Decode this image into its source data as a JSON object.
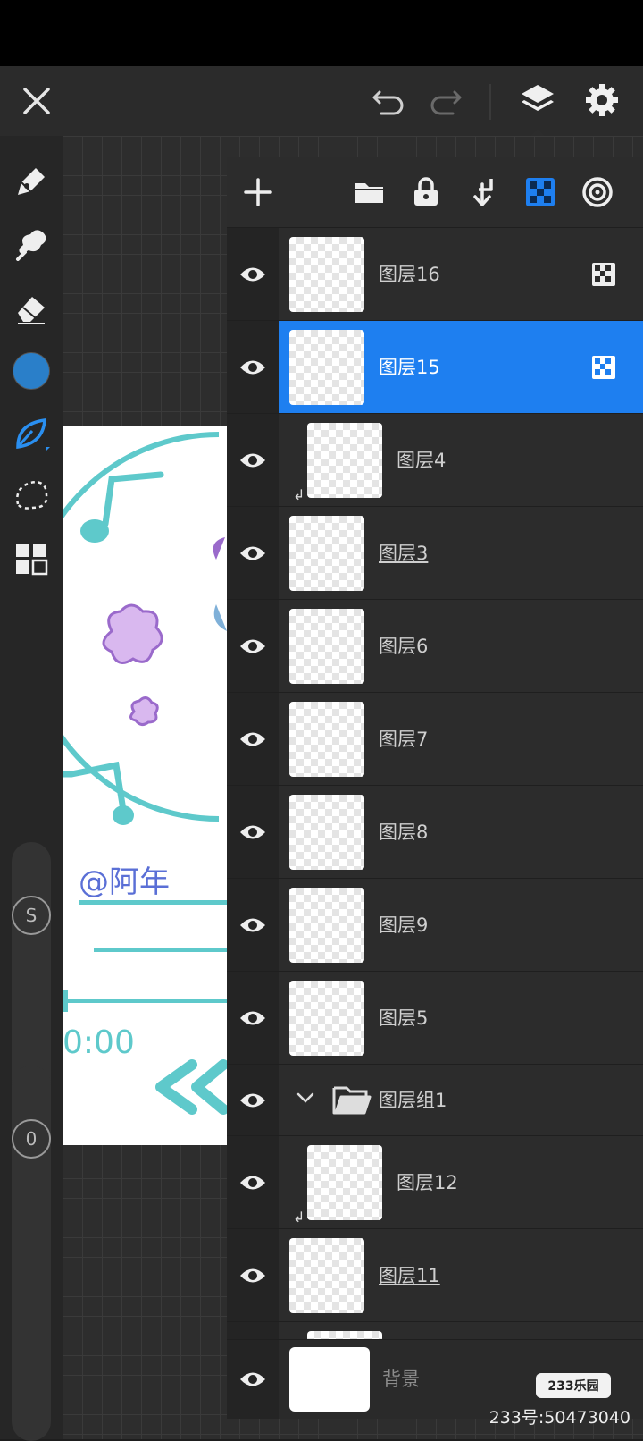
{
  "colors": {
    "accent": "#1e7ff0",
    "current_color": "#2a7fc9",
    "panel_bg": "#2c2c2c"
  },
  "topbar": {
    "icons": [
      "close-icon",
      "undo-icon",
      "redo-icon",
      "layers-icon",
      "settings-icon"
    ]
  },
  "tools": {
    "items": [
      "pen-icon",
      "smudge-icon",
      "eraser-icon",
      "color-swatch",
      "ink-brush-icon",
      "lasso-selection-icon",
      "grid-menu-icon"
    ],
    "size_label": "S",
    "opacity_label": "0"
  },
  "artwork": {
    "handle": "@阿年",
    "time": "0:00"
  },
  "layers_panel": {
    "header_icons": [
      "add-layer-icon",
      "folder-icon",
      "lock-icon",
      "clip-mask-icon",
      "alpha-lock-icon",
      "blend-icon"
    ],
    "layers": [
      {
        "name": "图层16",
        "selected": false,
        "clipped": false,
        "alpha_locked": true,
        "underlined": false
      },
      {
        "name": "图层15",
        "selected": true,
        "clipped": false,
        "alpha_locked": true,
        "underlined": false
      },
      {
        "name": "图层4",
        "selected": false,
        "clipped": true,
        "alpha_locked": false,
        "underlined": false
      },
      {
        "name": "图层3",
        "selected": false,
        "clipped": false,
        "alpha_locked": false,
        "underlined": true
      },
      {
        "name": "图层6",
        "selected": false,
        "clipped": false,
        "alpha_locked": false,
        "underlined": false
      },
      {
        "name": "图层7",
        "selected": false,
        "clipped": false,
        "alpha_locked": false,
        "underlined": false
      },
      {
        "name": "图层8",
        "selected": false,
        "clipped": false,
        "alpha_locked": false,
        "underlined": false
      },
      {
        "name": "图层9",
        "selected": false,
        "clipped": false,
        "alpha_locked": false,
        "underlined": false
      },
      {
        "name": "图层5",
        "selected": false,
        "clipped": false,
        "alpha_locked": false,
        "underlined": false
      }
    ],
    "group": {
      "name": "图层组1",
      "expanded": true
    },
    "group_layers": [
      {
        "name": "图层12",
        "clipped": true,
        "underlined": false
      },
      {
        "name": "图层11",
        "clipped": false,
        "underlined": true
      }
    ],
    "background": {
      "name": "背景"
    }
  },
  "watermark": {
    "logo": "233乐园",
    "text": "233号:50473040"
  }
}
